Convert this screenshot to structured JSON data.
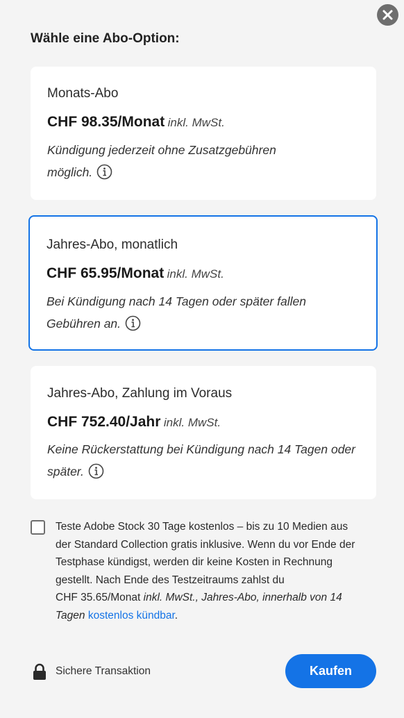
{
  "heading": "Wähle eine Abo-Option:",
  "plans": [
    {
      "name": "Monats-Abo",
      "price": "CHF 98.35/Monat",
      "tax": "inkl. MwSt.",
      "note_line1": "Kündigung jederzeit ohne Zusatzgebühren",
      "note_line2": "möglich.",
      "selected": false
    },
    {
      "name": "Jahres-Abo, monatlich",
      "price": "CHF 65.95/Monat",
      "tax": "inkl. MwSt.",
      "note_line1": "Bei Kündigung nach 14 Tagen oder später fallen",
      "note_line2": "Gebühren an.",
      "selected": true
    },
    {
      "name": "Jahres-Abo, Zahlung im Voraus",
      "price": "CHF 752.40/Jahr",
      "tax": "inkl. MwSt.",
      "note_line1": "Keine Rückerstattung bei Kündigung nach 14 Tagen oder",
      "note_line2": "später.",
      "selected": false
    }
  ],
  "trial": {
    "checked": false,
    "line1": "Teste Adobe Stock 30 Tage kostenlos – bis zu 10 Medien aus",
    "line2": "der Standard Collection gratis inklusive. Wenn du vor Ende der",
    "line3": "Testphase kündigst, werden dir keine Kosten in Rechnung",
    "line4": "gestellt. Nach Ende des Testzeitraums zahlst du",
    "line5_price": "CHF 35.65/Monat",
    "line5_rest": "inkl. MwSt., Jahres-Abo, innerhalb von 14",
    "line6_start": "Tagen",
    "link_text": "kostenlos kündbar",
    "line6_end": "."
  },
  "footer": {
    "secure_label": "Sichere Transaktion",
    "buy_label": "Kaufen"
  },
  "colors": {
    "accent": "#1473e6",
    "background": "#f4f4f4",
    "card": "#ffffff"
  },
  "icons": [
    "close-icon",
    "info-icon",
    "lock-icon"
  ]
}
